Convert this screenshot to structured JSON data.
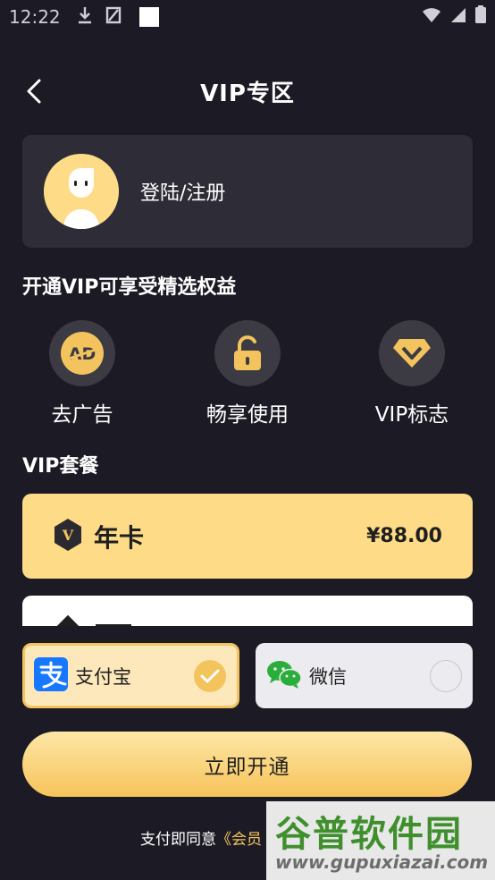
{
  "status_bar": {
    "time": "12:22",
    "icons": [
      "download-icon",
      "signal-blocked-icon",
      "wifi-icon",
      "cell-signal-icon",
      "battery-icon"
    ]
  },
  "header": {
    "title": "VIP专区",
    "back_icon": "chevron-left-icon"
  },
  "login": {
    "label": "登陆/注册",
    "avatar_icon": "default-avatar-icon"
  },
  "benefits": {
    "title": "开通VIP可享受精选权益",
    "items": [
      {
        "label": "去广告",
        "icon": "ad-remove-icon"
      },
      {
        "label": "畅享使用",
        "icon": "unlock-icon"
      },
      {
        "label": "VIP标志",
        "icon": "vip-diamond-icon"
      }
    ]
  },
  "plans": {
    "title": "VIP套餐",
    "items": [
      {
        "name": "年卡",
        "price": "¥88.00",
        "selected": true,
        "icon": "vip-hexagon-icon"
      }
    ]
  },
  "payment": {
    "options": [
      {
        "label": "支付宝",
        "icon": "alipay-icon",
        "selected": true
      },
      {
        "label": "微信",
        "icon": "wechat-icon",
        "selected": false
      }
    ]
  },
  "submit": {
    "label": "立即开通"
  },
  "agreement": {
    "prefix": "支付即同意",
    "link": "《会员"
  },
  "watermark": {
    "title": "谷普软件园",
    "subtitle": "www.gupuxiazai.com"
  },
  "colors": {
    "background": "#1c1b25",
    "card": "#2e2d37",
    "accent": "#fddb87",
    "accent_strong": "#f3c45e"
  }
}
